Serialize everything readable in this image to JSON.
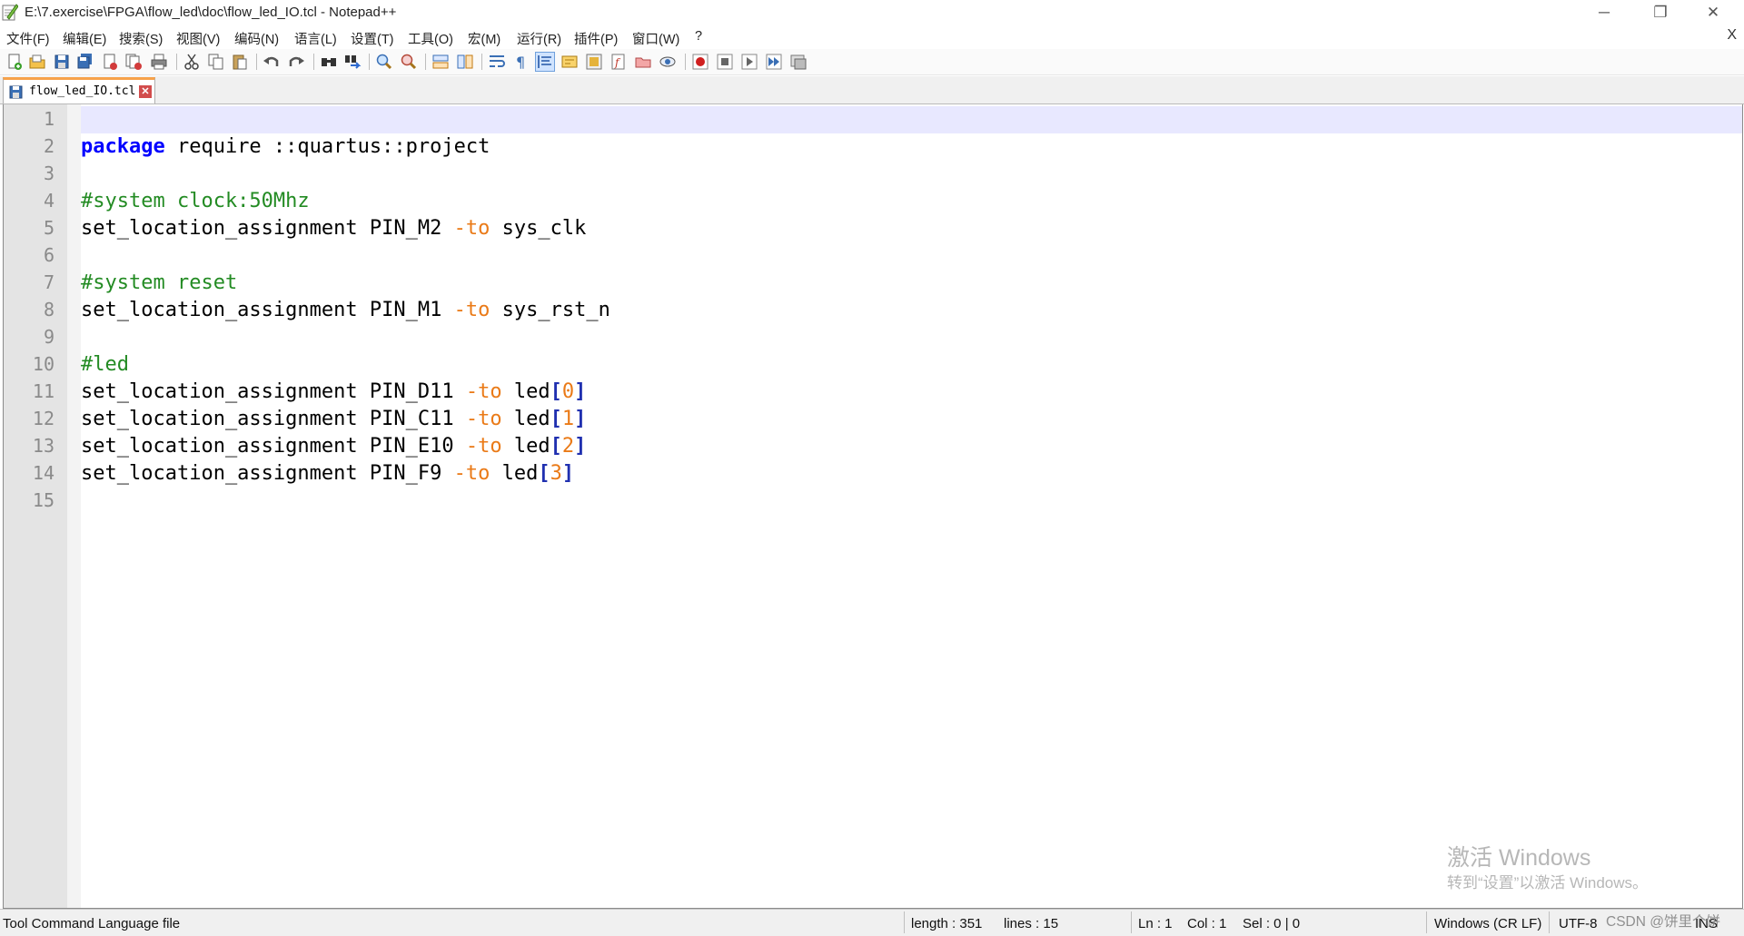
{
  "window": {
    "title": "E:\\7.exercise\\FPGA\\flow_led\\doc\\flow_led_IO.tcl - Notepad++",
    "minimize": "─",
    "restore": "❐",
    "close": "✕"
  },
  "menu": {
    "items": [
      "文件(F)",
      "编辑(E)",
      "搜索(S)",
      "视图(V)",
      "编码(N)",
      "语言(L)",
      "设置(T)",
      "工具(O)",
      "宏(M)",
      "运行(R)",
      "插件(P)",
      "窗口(W)",
      "?"
    ],
    "close_label": "X"
  },
  "toolbar": {
    "icons": [
      "new-file-icon",
      "open-file-icon",
      "save-icon",
      "save-all-icon",
      "close-icon",
      "close-all-icon",
      "print-icon",
      "cut-icon",
      "copy-icon",
      "paste-icon",
      "undo-icon",
      "redo-icon",
      "find-icon",
      "replace-icon",
      "zoom-in-icon",
      "zoom-out-icon",
      "sync-vertical-icon",
      "sync-horizontal-icon",
      "word-wrap-icon",
      "show-all-chars-icon",
      "indent-guide-icon",
      "doc-map-icon",
      "function-list-icon",
      "folder-workspace-icon",
      "document-list-icon",
      "monitoring-icon",
      "record-macro-icon",
      "stop-macro-icon",
      "play-macro-icon",
      "run-macro-multiple-icon",
      "save-macro-icon"
    ]
  },
  "tab": {
    "label": "flow_led_IO.tcl",
    "close": "✕"
  },
  "editor": {
    "line_numbers": [
      "1",
      "2",
      "3",
      "4",
      "5",
      "6",
      "7",
      "8",
      "9",
      "10",
      "11",
      "12",
      "13",
      "14",
      "15"
    ],
    "lines": [
      {
        "parts": []
      },
      {
        "parts": [
          {
            "t": "package",
            "c": "kw"
          },
          {
            "t": " require ::quartus::project",
            "c": ""
          }
        ]
      },
      {
        "parts": []
      },
      {
        "parts": [
          {
            "t": "#system clock:50Mhz",
            "c": "cm"
          }
        ]
      },
      {
        "parts": [
          {
            "t": "set_location_assignment PIN_M2 ",
            "c": ""
          },
          {
            "t": "-to",
            "c": "op"
          },
          {
            "t": " sys_clk",
            "c": ""
          }
        ]
      },
      {
        "parts": []
      },
      {
        "parts": [
          {
            "t": "#system reset",
            "c": "cm"
          }
        ]
      },
      {
        "parts": [
          {
            "t": "set_location_assignment PIN_M1 ",
            "c": ""
          },
          {
            "t": "-to",
            "c": "op"
          },
          {
            "t": " sys_rst_n",
            "c": ""
          }
        ]
      },
      {
        "parts": []
      },
      {
        "parts": [
          {
            "t": "#led",
            "c": "cm"
          }
        ]
      },
      {
        "parts": [
          {
            "t": "set_location_assignment PIN_D11 ",
            "c": ""
          },
          {
            "t": "-to",
            "c": "op"
          },
          {
            "t": " led",
            "c": ""
          },
          {
            "t": "[",
            "c": "br"
          },
          {
            "t": "0",
            "c": "nm"
          },
          {
            "t": "]",
            "c": "br"
          }
        ]
      },
      {
        "parts": [
          {
            "t": "set_location_assignment PIN_C11 ",
            "c": ""
          },
          {
            "t": "-to",
            "c": "op"
          },
          {
            "t": " led",
            "c": ""
          },
          {
            "t": "[",
            "c": "br"
          },
          {
            "t": "1",
            "c": "nm"
          },
          {
            "t": "]",
            "c": "br"
          }
        ]
      },
      {
        "parts": [
          {
            "t": "set_location_assignment PIN_E10 ",
            "c": ""
          },
          {
            "t": "-to",
            "c": "op"
          },
          {
            "t": " led",
            "c": ""
          },
          {
            "t": "[",
            "c": "br"
          },
          {
            "t": "2",
            "c": "nm"
          },
          {
            "t": "]",
            "c": "br"
          }
        ]
      },
      {
        "parts": [
          {
            "t": "set_location_assignment PIN_F9 ",
            "c": ""
          },
          {
            "t": "-to",
            "c": "op"
          },
          {
            "t": " led",
            "c": ""
          },
          {
            "t": "[",
            "c": "br"
          },
          {
            "t": "3",
            "c": "nm"
          },
          {
            "t": "]",
            "c": "br"
          }
        ]
      },
      {
        "parts": []
      }
    ],
    "current_line": 1
  },
  "watermark": {
    "line1": "激活 Windows",
    "line2": "转到“设置”以激活 Windows。"
  },
  "status": {
    "language": "Tool Command Language file",
    "length": "length : 351",
    "lines": "lines : 15",
    "ln": "Ln : 1",
    "col": "Col : 1",
    "sel": "Sel : 0 | 0",
    "eol": "Windows (CR LF)",
    "encoding": "UTF-8",
    "mode": "INS"
  },
  "overlay": {
    "csdn": "CSDN @饼里个饼"
  },
  "colors": {
    "keyword": "#0000ff",
    "comment": "#238b23",
    "operator": "#ea7a17",
    "bracket": "#2030b0",
    "current_line": "#e8e8ff",
    "tab_accent": "#f7a24a"
  }
}
